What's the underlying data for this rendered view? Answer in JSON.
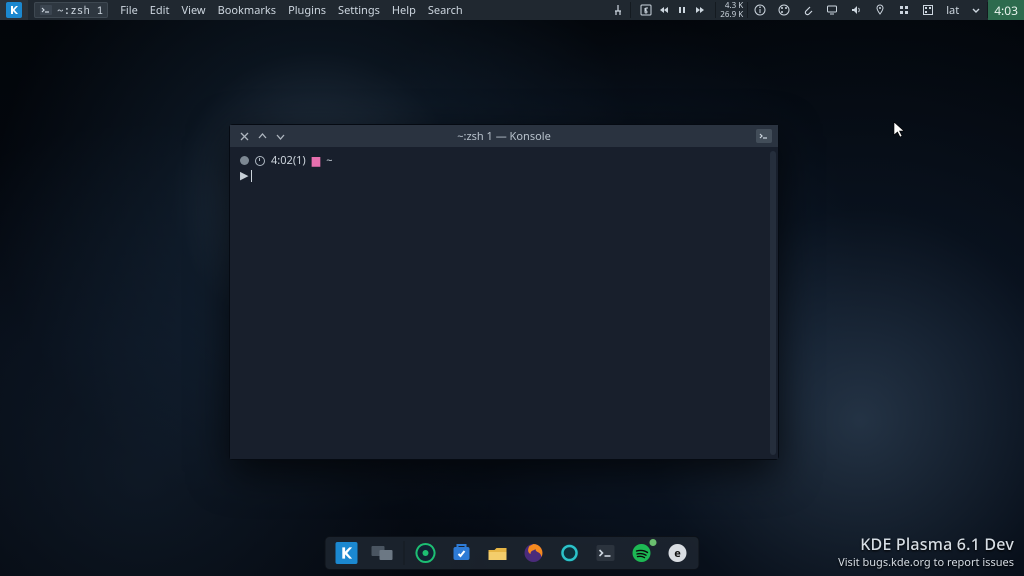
{
  "top_panel": {
    "task_chip": {
      "label": "~:zsh 1"
    },
    "menubar": [
      "File",
      "Edit",
      "View",
      "Bookmarks",
      "Plugins",
      "Settings",
      "Help",
      "Search"
    ],
    "net": {
      "up": "4.3 K",
      "down": "26.9 K"
    },
    "kb_layout": "lat",
    "clock": "4:03"
  },
  "konsole": {
    "title": "~:zsh 1 — Konsole",
    "prompt_time": "4:02(1)",
    "prompt_dir": "~",
    "prompt_sym": "▶"
  },
  "bottom_info": {
    "title": "KDE Plasma 6.1 Dev",
    "subtitle": "Visit bugs.kde.org to report issues"
  },
  "dock": {
    "items": [
      {
        "name": "kde-launcher-icon"
      },
      {
        "name": "task-switcher-icon"
      },
      {
        "name": "app-green1-icon"
      },
      {
        "name": "discover-icon"
      },
      {
        "name": "dolphin-icon"
      },
      {
        "name": "firefox-icon"
      },
      {
        "name": "app-teal-icon"
      },
      {
        "name": "konsole-icon"
      },
      {
        "name": "spotify-icon"
      },
      {
        "name": "app-round-icon"
      }
    ]
  }
}
